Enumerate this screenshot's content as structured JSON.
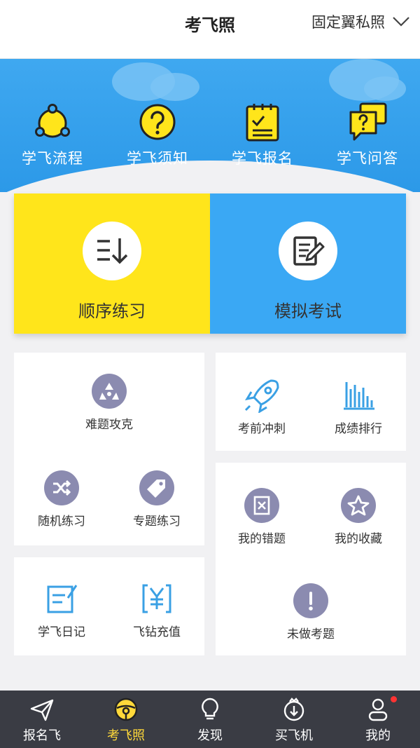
{
  "header": {
    "title": "考飞照",
    "license_type": "固定翼私照"
  },
  "banner": {
    "items": [
      {
        "label": "学飞流程",
        "icon": "process-cycle-icon"
      },
      {
        "label": "学飞须知",
        "icon": "question-icon"
      },
      {
        "label": "学飞报名",
        "icon": "clipboard-signup-icon"
      },
      {
        "label": "学飞问答",
        "icon": "qa-chat-icon"
      }
    ]
  },
  "practice": {
    "sequential": {
      "label": "顺序练习",
      "icon": "sort-list-icon"
    },
    "mock_exam": {
      "label": "模拟考试",
      "icon": "exam-edit-icon"
    }
  },
  "tiles": {
    "hard": "难题攻克",
    "sprint": "考前冲刺",
    "ranking": "成绩排行",
    "random": "随机练习",
    "topic": "专题练习",
    "mistakes": "我的错题",
    "favorites": "我的收藏",
    "diary": "学飞日记",
    "recharge": "飞钻充值",
    "undone": "未做考题"
  },
  "tabbar": {
    "items": [
      {
        "label": "报名飞",
        "icon": "paper-plane-icon",
        "active": false
      },
      {
        "label": "考飞照",
        "icon": "steering-wheel-icon",
        "active": true
      },
      {
        "label": "发现",
        "icon": "lightbulb-icon",
        "active": false
      },
      {
        "label": "买飞机",
        "icon": "shopping-bag-icon",
        "active": false
      },
      {
        "label": "我的",
        "icon": "user-icon",
        "active": false
      }
    ]
  },
  "colors": {
    "banner_blue": "#3fa8f0",
    "seq_yellow": "#ffe51b",
    "mock_blue": "#3aa8f4",
    "tile_icon_purple": "#8b8bb0",
    "accent_blue": "#3aa0e4",
    "tabbar_bg": "#3a3c44",
    "tab_active": "#ffd93a"
  }
}
